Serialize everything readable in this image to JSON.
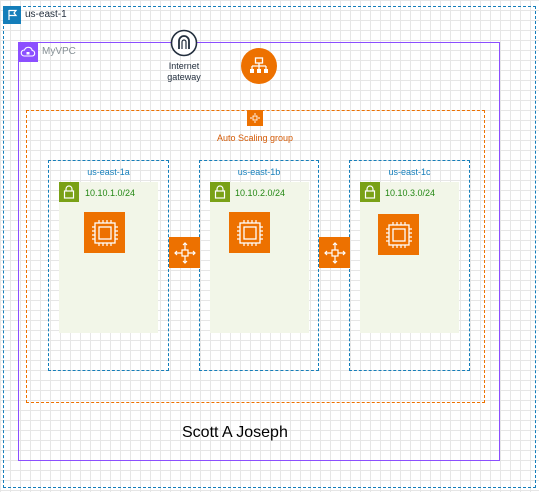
{
  "region": {
    "label": "us-east-1",
    "icon": "flag-icon"
  },
  "vpc": {
    "label": "MyVPC",
    "icon": "cloud-lock-icon"
  },
  "internet_gateway": {
    "label_line1": "Internet",
    "label_line2": "gateway",
    "icon": "internet-gateway-icon"
  },
  "load_balancer": {
    "icon": "application-load-balancer-icon"
  },
  "auto_scaling_group": {
    "label": "Auto Scaling group",
    "icon": "auto-scaling-icon"
  },
  "availability_zones": [
    {
      "label": "us-east-1a",
      "subnet": "10.10.1.0/24"
    },
    {
      "label": "us-east-1b",
      "subnet": "10.10.2.0/24"
    },
    {
      "label": "us-east-1c",
      "subnet": "10.10.3.0/24"
    }
  ],
  "author": "Scott A Joseph",
  "colors": {
    "region_border": "#147eba",
    "vpc_border": "#8c4fff",
    "asg_border": "#ed7100",
    "compute_orange": "#ed7100",
    "subnet_fill": "#f2f6e8",
    "subnet_lock": "#7aa116"
  }
}
